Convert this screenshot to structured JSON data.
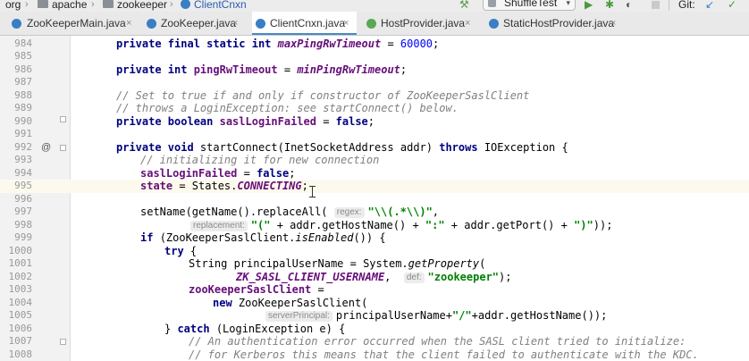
{
  "breadcrumb": {
    "items": [
      "org",
      "apache",
      "zookeeper",
      "ClientCnxn"
    ],
    "separator": "›"
  },
  "toolbar": {
    "run_config": "ShuffleTest",
    "vcs_label": "Git:"
  },
  "tabs": [
    {
      "label": "ZooKeeperMain.java",
      "active": false,
      "icon_color": "#3a7ec4"
    },
    {
      "label": "ZooKeeper.java",
      "active": false,
      "icon_color": "#3a7ec4"
    },
    {
      "label": "ClientCnxn.java",
      "active": true,
      "icon_color": "#3a7ec4"
    },
    {
      "label": "HostProvider.java",
      "active": false,
      "icon_color": "#5aa854"
    },
    {
      "label": "StaticHostProvider.java",
      "active": false,
      "icon_color": "#3a7ec4"
    }
  ],
  "tab_close": "×",
  "gutter": {
    "override_marker": "@"
  },
  "line_numbers": [
    "984",
    "985",
    "986",
    "987",
    "988",
    "989",
    "990",
    "991",
    "992",
    "993",
    "994",
    "995",
    "996",
    "997",
    "998",
    "999",
    "1000",
    "1001",
    "1002",
    "1003",
    "1004",
    "1005",
    "1006",
    "1007",
    "1008"
  ],
  "code": {
    "l984": {
      "kw": "private final static int ",
      "fld": "maxPingRwTimeout",
      "rest": " = ",
      "num": "60000",
      "end": ";"
    },
    "l986": {
      "kw": "private int ",
      "fld": "pingRwTimeout",
      "rest": " = ",
      "fld2": "minPingRwTimeout",
      "end": ";"
    },
    "l988": {
      "cmt": "// Set to true if and only if constructor of ZooKeeperSaslClient"
    },
    "l989": {
      "cmt": "// throws a LoginException: see startConnect() below."
    },
    "l990": {
      "kw": "private boolean ",
      "fld": "saslLoginFailed",
      "rest": " = ",
      "kw2": "false",
      "end": ";"
    },
    "l992": {
      "kw": "private void ",
      "rest": "startConnect(InetSocketAddress addr) ",
      "kw2": "throws ",
      "end": "IOException {"
    },
    "l993": {
      "cmt": "// initializing it for new connection"
    },
    "l994": {
      "fld": "saslLoginFailed",
      "rest": " = ",
      "kw": "false",
      "end": ";"
    },
    "l995": {
      "fld": "state",
      "rest": " = States.",
      "st": "CONNECTING",
      "end": ";"
    },
    "l997": {
      "rest": "setName(getName().replaceAll(",
      "hint": "regex:",
      "str": "\"\\\\(.*\\\\)\"",
      "end": ","
    },
    "l998": {
      "hint": "replacement:",
      "str": "\"(\"",
      "rest": " + addr.getHostName() + ",
      "str2": "\":\"",
      "rest2": " + addr.getPort() + ",
      "str3": "\")\"",
      "end": "));"
    },
    "l999": {
      "kw": "if ",
      "rest": "(ZooKeeperSaslClient.",
      "st": "isEnabled",
      "end": "()) {"
    },
    "l1000": {
      "kw": "try ",
      "end": "{"
    },
    "l1001": {
      "rest": "String principalUserName = System.",
      "st": "getProperty",
      "end": "("
    },
    "l1002": {
      "fldi": "ZK_SASL_CLIENT_USERNAME",
      "rest": ", ",
      "hint": "def:",
      "str": "\"zookeeper\"",
      "end": ");"
    },
    "l1003": {
      "fld": "zooKeeperSaslClient",
      "end": " ="
    },
    "l1004": {
      "kw": "new ",
      "end": "ZooKeeperSaslClient("
    },
    "l1005": {
      "hint": "serverPrincipal:",
      "rest": "principalUserName+",
      "str": "\"/\"",
      "end": "+addr.getHostName());"
    },
    "l1006": {
      "rest": "} ",
      "kw": "catch ",
      "end": "(LoginException e) {"
    },
    "l1007": {
      "cmt": "// An authentication error occurred when the SASL client tried to initialize:"
    },
    "l1008": {
      "cmt": "// for Kerberos this means that the client failed to authenticate with the KDC."
    }
  }
}
